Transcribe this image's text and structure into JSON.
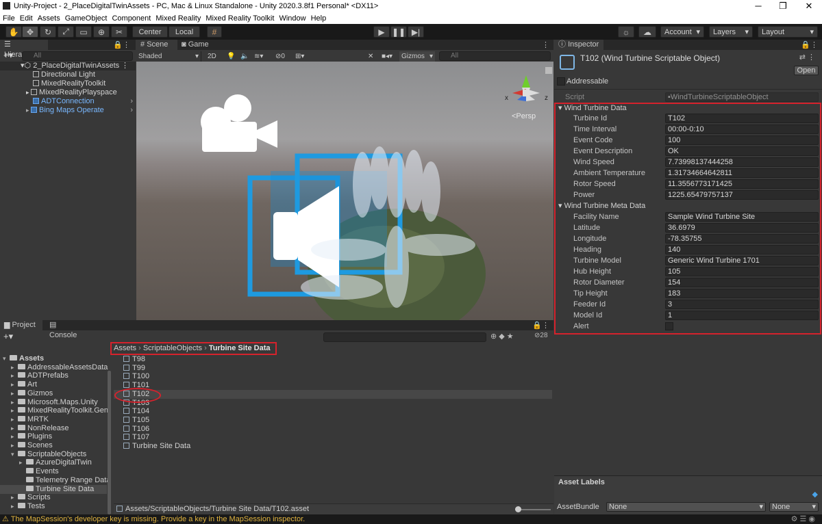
{
  "window": {
    "title": "Unity-Project - 2_PlaceDigitalTwinAssets - PC, Mac & Linux Standalone - Unity 2020.3.8f1 Personal* <DX11>",
    "minimize": "─",
    "maximize": "❐",
    "close": "✕"
  },
  "menu": [
    "File",
    "Edit",
    "Assets",
    "GameObject",
    "Component",
    "Mixed Reality",
    "Mixed Reality Toolkit",
    "Window",
    "Help"
  ],
  "toolbar": {
    "pivot_center": "Center",
    "pivot_local": "Local",
    "account": "Account",
    "layers": "Layers",
    "layout": "Layout"
  },
  "hierarchy": {
    "tab": "Hierarchy",
    "search_placeholder": "All",
    "scene_name": "2_PlaceDigitalTwinAssets",
    "items": [
      {
        "label": "Directional Light"
      },
      {
        "label": "MixedRealityToolkit"
      },
      {
        "label": "MixedRealityPlayspace"
      },
      {
        "label": "ADTConnection"
      },
      {
        "label": "Bing Maps Operate"
      }
    ]
  },
  "scene": {
    "tab_scene": "Scene",
    "tab_game": "Game",
    "shading": "Shaded",
    "mode_2d": "2D",
    "hidden_count": "0",
    "gizmos": "Gizmos",
    "search_placeholder": "All",
    "persp": "<Persp",
    "axis_x": "x",
    "axis_z": "z"
  },
  "project": {
    "tab_project": "Project",
    "tab_console": "Console",
    "hidden_count": "28",
    "tree": [
      {
        "label": "Assets",
        "depth": 0
      },
      {
        "label": "AddressableAssetsData",
        "depth": 1
      },
      {
        "label": "ADTPrefabs",
        "depth": 1
      },
      {
        "label": "Art",
        "depth": 1
      },
      {
        "label": "Gizmos",
        "depth": 1
      },
      {
        "label": "Microsoft.Maps.Unity",
        "depth": 1
      },
      {
        "label": "MixedRealityToolkit.Gen",
        "depth": 1
      },
      {
        "label": "MRTK",
        "depth": 1
      },
      {
        "label": "NonRelease",
        "depth": 1
      },
      {
        "label": "Plugins",
        "depth": 1
      },
      {
        "label": "Scenes",
        "depth": 1
      },
      {
        "label": "ScriptableObjects",
        "depth": 1
      },
      {
        "label": "AzureDigitalTwin",
        "depth": 2
      },
      {
        "label": "Events",
        "depth": 2
      },
      {
        "label": "Telemetry Range Data",
        "depth": 2
      },
      {
        "label": "Turbine Site Data",
        "depth": 2
      },
      {
        "label": "Scripts",
        "depth": 1
      },
      {
        "label": "Tests",
        "depth": 1
      }
    ],
    "breadcrumb": [
      "Assets",
      "ScriptableObjects",
      "Turbine Site Data"
    ],
    "files": [
      "T98",
      "T99",
      "T100",
      "T101",
      "T102",
      "T103",
      "T104",
      "T105",
      "T106",
      "T107",
      "Turbine Site Data"
    ],
    "selected_file": "T102",
    "path": "Assets/ScriptableObjects/Turbine Site Data/T102.asset"
  },
  "inspector": {
    "tab": "Inspector",
    "object_title": "T102 (Wind Turbine Scriptable Object)",
    "open_button": "Open",
    "addressable": "Addressable",
    "script_label": "Script",
    "script_value": "WindTurbineScriptableObject",
    "section_data": "Wind Turbine Data",
    "data_fields": [
      {
        "label": "Turbine Id",
        "value": "T102"
      },
      {
        "label": "Time Interval",
        "value": "00:00-0:10"
      },
      {
        "label": "Event Code",
        "value": "100"
      },
      {
        "label": "Event Description",
        "value": "OK"
      },
      {
        "label": "Wind Speed",
        "value": "7.73998137444258"
      },
      {
        "label": "Ambient Temperature",
        "value": "1.31734664642811"
      },
      {
        "label": "Rotor Speed",
        "value": "11.3556773171425"
      },
      {
        "label": "Power",
        "value": "1225.65479757137"
      }
    ],
    "section_meta": "Wind Turbine Meta Data",
    "meta_fields": [
      {
        "label": "Facility Name",
        "value": "Sample Wind Turbine Site"
      },
      {
        "label": "Latitude",
        "value": "36.6979"
      },
      {
        "label": "Longitude",
        "value": "-78.35755"
      },
      {
        "label": "Heading",
        "value": "140"
      },
      {
        "label": "Turbine Model",
        "value": "Generic Wind Turbine 1701"
      },
      {
        "label": "Hub Height",
        "value": "105"
      },
      {
        "label": "Rotor Diameter",
        "value": "154"
      },
      {
        "label": "Tip Height",
        "value": "183"
      },
      {
        "label": "Feeder Id",
        "value": "3"
      },
      {
        "label": "Model Id",
        "value": "1"
      }
    ],
    "alert_label": "Alert",
    "asset_labels": "Asset Labels",
    "asset_bundle_label": "AssetBundle",
    "asset_bundle_value": "None",
    "asset_bundle_variant": "None"
  },
  "status": {
    "message": "The MapSession's developer key is missing. Provide a key in the MapSession inspector."
  },
  "colors": {
    "highlight_red": "#d6222c",
    "link_blue": "#79b8ff",
    "panel_bg": "#383838"
  }
}
